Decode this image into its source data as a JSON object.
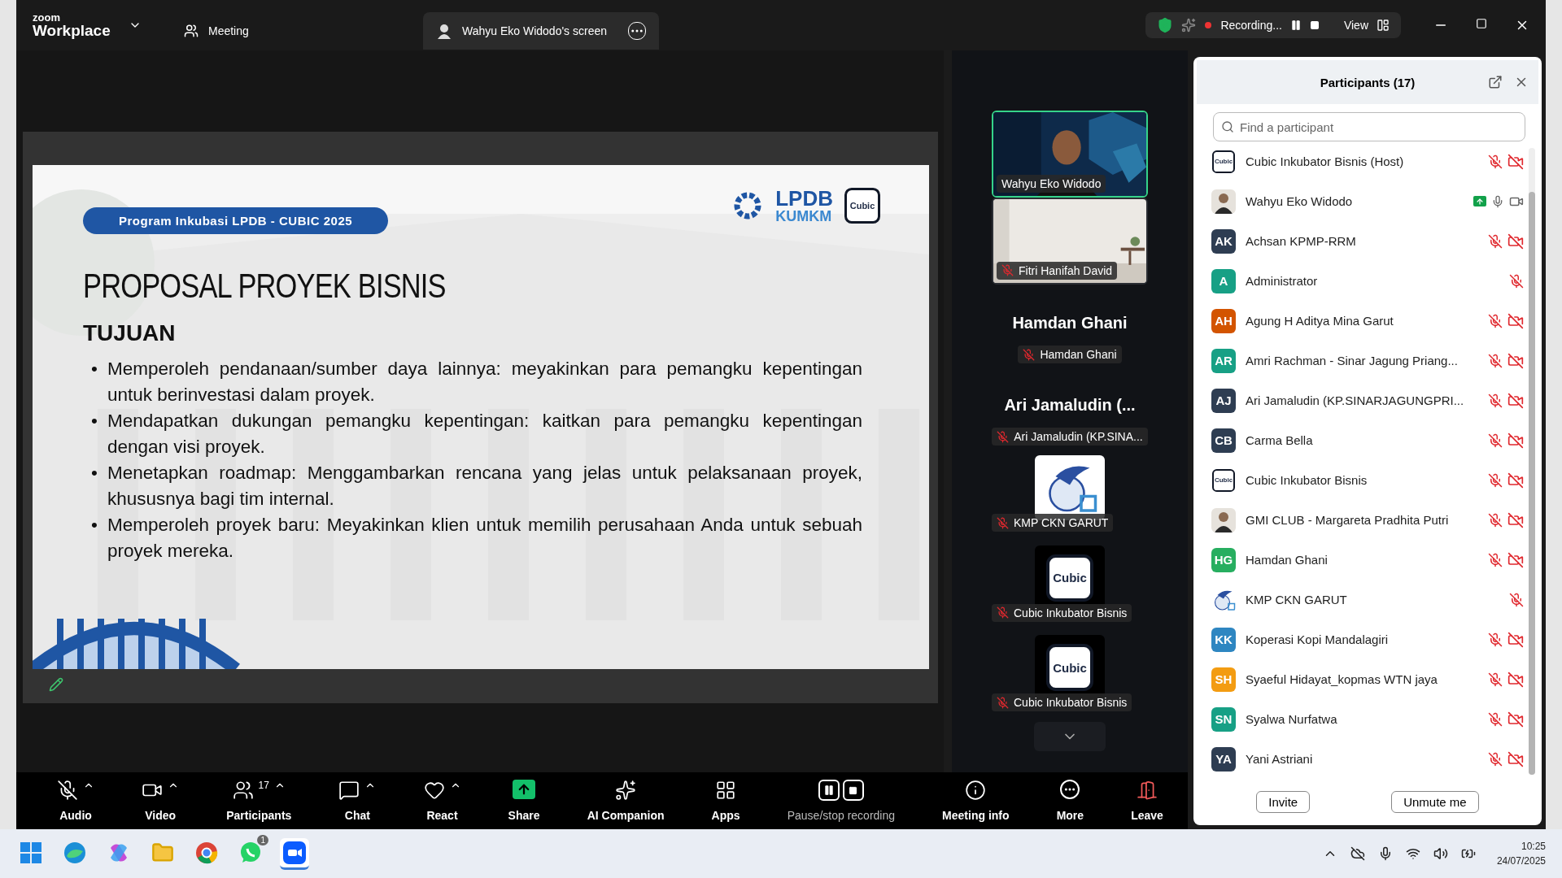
{
  "titlebar": {
    "brand_small": "zoom",
    "brand": "Workplace",
    "tabs": [
      {
        "label": "Meeting",
        "kind": "meeting",
        "selected": false
      },
      {
        "label": "Wahyu Eko Widodo's screen",
        "kind": "screen",
        "selected": true
      }
    ],
    "recording": "Recording...",
    "view": "View"
  },
  "slide": {
    "badge": "Program Inkubasi LPDB - CUBIC 2025",
    "logo_main": "LPDB",
    "logo_sub": "KUMKM",
    "logo_box": "Cubic",
    "title": "PROPOSAL PROYEK BISNIS",
    "heading": "TUJUAN",
    "marker": "•",
    "bullets": [
      "Memperoleh pendanaan/sumber daya lainnya: meyakinkan para pemangku kepentingan untuk berinvestasi dalam proyek.",
      "Mendapatkan dukungan pemangku kepentingan: kaitkan para pemangku kepentingan dengan visi proyek.",
      "Menetapkan roadmap: Menggambarkan rencana yang jelas untuk pelaksanaan proyek, khususnya bagi tim internal.",
      "Memperoleh proyek baru: Meyakinkan klien untuk memilih perusahaan Anda untuk sebuah proyek mereka."
    ]
  },
  "gallery": [
    {
      "kind": "video",
      "name": "Wahyu Eko Widodo",
      "muted": false,
      "speaking": true
    },
    {
      "kind": "video",
      "name": "Fitri Hanifah David",
      "muted": true,
      "speaking": false
    },
    {
      "kind": "name",
      "display": "Hamdan Ghani",
      "name": "Hamdan Ghani",
      "muted": true
    },
    {
      "kind": "name",
      "display": "Ari Jamaludin (...",
      "name": "Ari Jamaludin (KP.SINA...",
      "muted": true
    },
    {
      "kind": "emblem",
      "name": "KMP CKN GARUT",
      "muted": true
    },
    {
      "kind": "cubic",
      "logo": "Cubic",
      "name": "Cubic Inkubator Bisnis",
      "muted": true
    },
    {
      "kind": "cubic",
      "logo": "Cubic",
      "name": "Cubic Inkubator Bisnis",
      "muted": true
    }
  ],
  "participants": {
    "title": "Participants (17)",
    "placeholder": "Find a participant",
    "items": [
      {
        "name": "Cubic Inkubator Bisnis (Host)",
        "kind": "cubic",
        "logo": "Cubic",
        "muted": true,
        "video_off": true
      },
      {
        "name": "Wahyu Eko Widodo",
        "muted": false,
        "video_off": false,
        "sharing": true
      },
      {
        "name": "Achsan KPMP-RRM",
        "kind": "initials",
        "initials": "AK",
        "color": "#2e3d52",
        "muted": true,
        "video_off": true
      },
      {
        "name": "Administrator",
        "kind": "initials",
        "initials": "A",
        "color": "#17a085",
        "muted": true
      },
      {
        "name": "Agung H Aditya Mina Garut",
        "kind": "initials",
        "initials": "AH",
        "color": "#d35400",
        "muted": true,
        "video_off": true
      },
      {
        "name": "Amri Rachman - Sinar Jagung Priang...",
        "kind": "initials",
        "initials": "AR",
        "color": "#17a085",
        "muted": true,
        "video_off": true
      },
      {
        "name": "Ari Jamaludin (KP.SINARJAGUNGPRI...",
        "kind": "initials",
        "initials": "AJ",
        "color": "#2e3d52",
        "muted": true,
        "video_off": true
      },
      {
        "name": "Carma Bella",
        "kind": "initials",
        "initials": "CB",
        "color": "#2e3d52",
        "muted": true,
        "video_off": true
      },
      {
        "name": "Cubic Inkubator Bisnis",
        "kind": "cubic",
        "logo": "Cubic",
        "muted": true,
        "video_off": true
      },
      {
        "name": "GMI CLUB - Margareta Pradhita Putri",
        "muted": true,
        "video_off": true
      },
      {
        "name": "Hamdan Ghani",
        "kind": "initials",
        "initials": "HG",
        "color": "#27ae60",
        "muted": true,
        "video_off": true
      },
      {
        "name": "KMP CKN GARUT",
        "kind": "emblem",
        "muted": true
      },
      {
        "name": "Koperasi Kopi Mandalagiri",
        "kind": "initials",
        "initials": "KK",
        "color": "#2e86c1",
        "muted": true,
        "video_off": true
      },
      {
        "name": "Syaeful Hidayat_kopmas WTN jaya",
        "kind": "initials",
        "initials": "SH",
        "color": "#f39c12",
        "muted": true,
        "video_off": true
      },
      {
        "name": "Syalwa Nurfatwa",
        "kind": "initials",
        "initials": "SN",
        "color": "#17a085",
        "muted": true,
        "video_off": true
      },
      {
        "name": "Yani Astriani",
        "kind": "initials",
        "initials": "YA",
        "color": "#2e3d52",
        "muted": true,
        "video_off": true
      }
    ],
    "buttons": [
      "Invite",
      "Unmute me"
    ]
  },
  "toolbar": [
    {
      "kind": "audio",
      "label": "Audio",
      "caret": true
    },
    {
      "kind": "video",
      "label": "Video",
      "caret": true
    },
    {
      "kind": "participants",
      "label": "Participants",
      "count": "17",
      "caret": true
    },
    {
      "kind": "chat",
      "label": "Chat",
      "caret": true
    },
    {
      "kind": "react",
      "label": "React",
      "caret": true
    },
    {
      "kind": "share",
      "label": "Share",
      "caret": false
    },
    {
      "kind": "ai",
      "label": "AI Companion",
      "caret": false
    },
    {
      "kind": "apps",
      "label": "Apps",
      "caret": false
    },
    {
      "kind": "recording",
      "label": "Pause/stop recording",
      "caret": false
    },
    {
      "kind": "info",
      "label": "Meeting info",
      "caret": false
    },
    {
      "kind": "more",
      "label": "More",
      "caret": false
    },
    {
      "kind": "leave",
      "label": "Leave",
      "caret": false
    }
  ],
  "taskbar": {
    "apps": [
      {
        "kind": "windows",
        "selected": false
      },
      {
        "kind": "edge",
        "selected": false
      },
      {
        "kind": "copilot",
        "selected": false
      },
      {
        "kind": "folder",
        "selected": false
      },
      {
        "kind": "chrome",
        "selected": false
      },
      {
        "kind": "whatsapp",
        "badge": "1",
        "selected": false
      },
      {
        "kind": "zoom",
        "selected": true
      }
    ],
    "time": "10:25",
    "date": "24/07/2025"
  }
}
